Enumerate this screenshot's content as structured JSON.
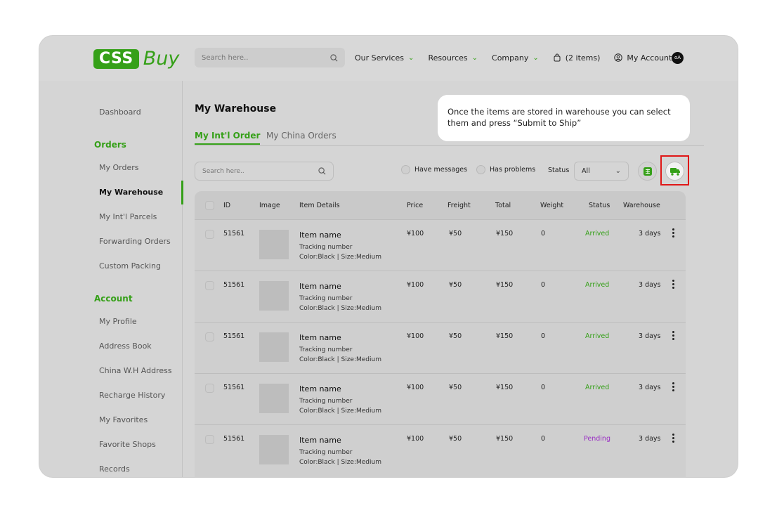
{
  "brand": {
    "logo_box": "CSS",
    "logo_text": "Buy"
  },
  "header": {
    "search_placeholder": "Search here..",
    "nav": {
      "services": "Our Services",
      "resources": "Resources",
      "company": "Company",
      "cart": "(2 items)",
      "account": "My Account",
      "avatar": "oA"
    }
  },
  "sidebar": {
    "dashboard": "Dashboard",
    "orders_head": "Orders",
    "my_orders": "My Orders",
    "my_warehouse": "My Warehouse",
    "intl_parcels": "My Int'l Parcels",
    "forwarding": "Forwarding Orders",
    "custom_packing": "Custom Packing",
    "account_head": "Account",
    "my_profile": "My Profile",
    "address_book": "Address Book",
    "china_address": "China W.H Address",
    "recharge": "Recharge History",
    "favorites": "My Favorites",
    "favorite_shops": "Favorite Shops",
    "records": "Records"
  },
  "main": {
    "title": "My Warehouse",
    "tabs": [
      "My Int'l Order",
      "My China Orders"
    ],
    "tooltip": "Once the items are stored in warehouse you can select them and press “Submit to Ship”",
    "search_placeholder": "Search here..",
    "filter_messages": "Have messages",
    "filter_problems": "Has problems",
    "status_label": "Status",
    "status_value": "All"
  },
  "table": {
    "headers": {
      "id": "ID",
      "image": "Image",
      "details": "Item Details",
      "price": "Price",
      "freight": "Freight",
      "total": "Total",
      "weight": "Weight",
      "status": "Status",
      "warehouse": "Warehouse"
    },
    "rows": [
      {
        "id": "51561",
        "name": "Item name",
        "tracking": "Tracking number",
        "attrs": "Color:Black | Size:Medium",
        "price": "¥100",
        "freight": "¥50",
        "total": "¥150",
        "weight": "0",
        "status": "Arrived",
        "warehouse": "3 days"
      },
      {
        "id": "51561",
        "name": "Item name",
        "tracking": "Tracking number",
        "attrs": "Color:Black | Size:Medium",
        "price": "¥100",
        "freight": "¥50",
        "total": "¥150",
        "weight": "0",
        "status": "Arrived",
        "warehouse": "3 days"
      },
      {
        "id": "51561",
        "name": "Item name",
        "tracking": "Tracking number",
        "attrs": "Color:Black | Size:Medium",
        "price": "¥100",
        "freight": "¥50",
        "total": "¥150",
        "weight": "0",
        "status": "Arrived",
        "warehouse": "3 days"
      },
      {
        "id": "51561",
        "name": "Item name",
        "tracking": "Tracking number",
        "attrs": "Color:Black | Size:Medium",
        "price": "¥100",
        "freight": "¥50",
        "total": "¥150",
        "weight": "0",
        "status": "Arrived",
        "warehouse": "3 days"
      },
      {
        "id": "51561",
        "name": "Item name",
        "tracking": "Tracking number",
        "attrs": "Color:Black | Size:Medium",
        "price": "¥100",
        "freight": "¥50",
        "total": "¥150",
        "weight": "0",
        "status": "Pending",
        "warehouse": "3 days"
      }
    ]
  },
  "colors": {
    "accent": "#35a018",
    "pending": "#9a2fc4",
    "highlight": "#e01717"
  },
  "icons": [
    "search-icon",
    "cart-icon",
    "user-icon",
    "excel-icon",
    "ship-truck-icon",
    "kebab-icon",
    "chevron-down-icon"
  ]
}
